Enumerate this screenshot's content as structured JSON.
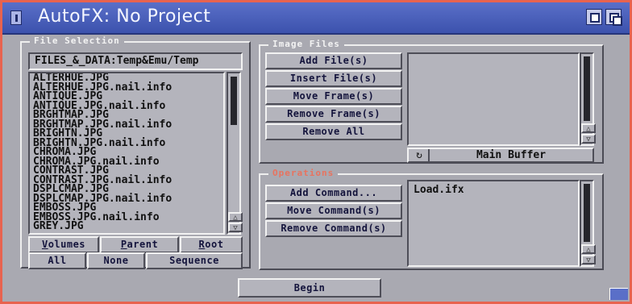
{
  "window": {
    "title": "AutoFX: No Project"
  },
  "file_selection": {
    "label": "File Selection",
    "path": "FILES_&_DATA:Temp&Emu/Temp",
    "files": [
      "ALTERHUE.JPG",
      "ALTERHUE.JPG.nail.info",
      "ANTIQUE.JPG",
      "ANTIQUE.JPG.nail.info",
      "BRGHTMAP.JPG",
      "BRGHTMAP.JPG.nail.info",
      "BRIGHTN.JPG",
      "BRIGHTN.JPG.nail.info",
      "CHROMA.JPG",
      "CHROMA.JPG.nail.info",
      "CONTRAST.JPG",
      "CONTRAST.JPG.nail.info",
      "DSPLCMAP.JPG",
      "DSPLCMAP.JPG.nail.info",
      "EMBOSS.JPG",
      "EMBOSS.JPG.nail.info",
      "GREY.JPG"
    ],
    "buttons": {
      "volumes_u": "V",
      "volumes_rest": "olumes",
      "parent_u": "P",
      "parent_rest": "arent",
      "root_u": "R",
      "root_rest": "oot",
      "all": "All",
      "none": "None",
      "sequence": "Sequence"
    }
  },
  "image_files": {
    "label": "Image Files",
    "buttons": {
      "add": "Add File(s)",
      "insert": "Insert File(s)",
      "move": "Move Frame(s)",
      "remove_frames": "Remove Frame(s)",
      "remove_all": "Remove All"
    },
    "buffer_label": "Main Buffer"
  },
  "operations": {
    "label": "Operations",
    "buttons": {
      "add": "Add Command...",
      "move": "Move Command(s)",
      "remove": "Remove Command(s)"
    },
    "items": [
      "Load.ifx"
    ]
  },
  "begin_label": "Begin",
  "colors": {
    "window_bg": "#a9a9b1",
    "titlebar": "#4a5fbd",
    "frame_border": "#e8634f",
    "button_text": "#14143c"
  }
}
